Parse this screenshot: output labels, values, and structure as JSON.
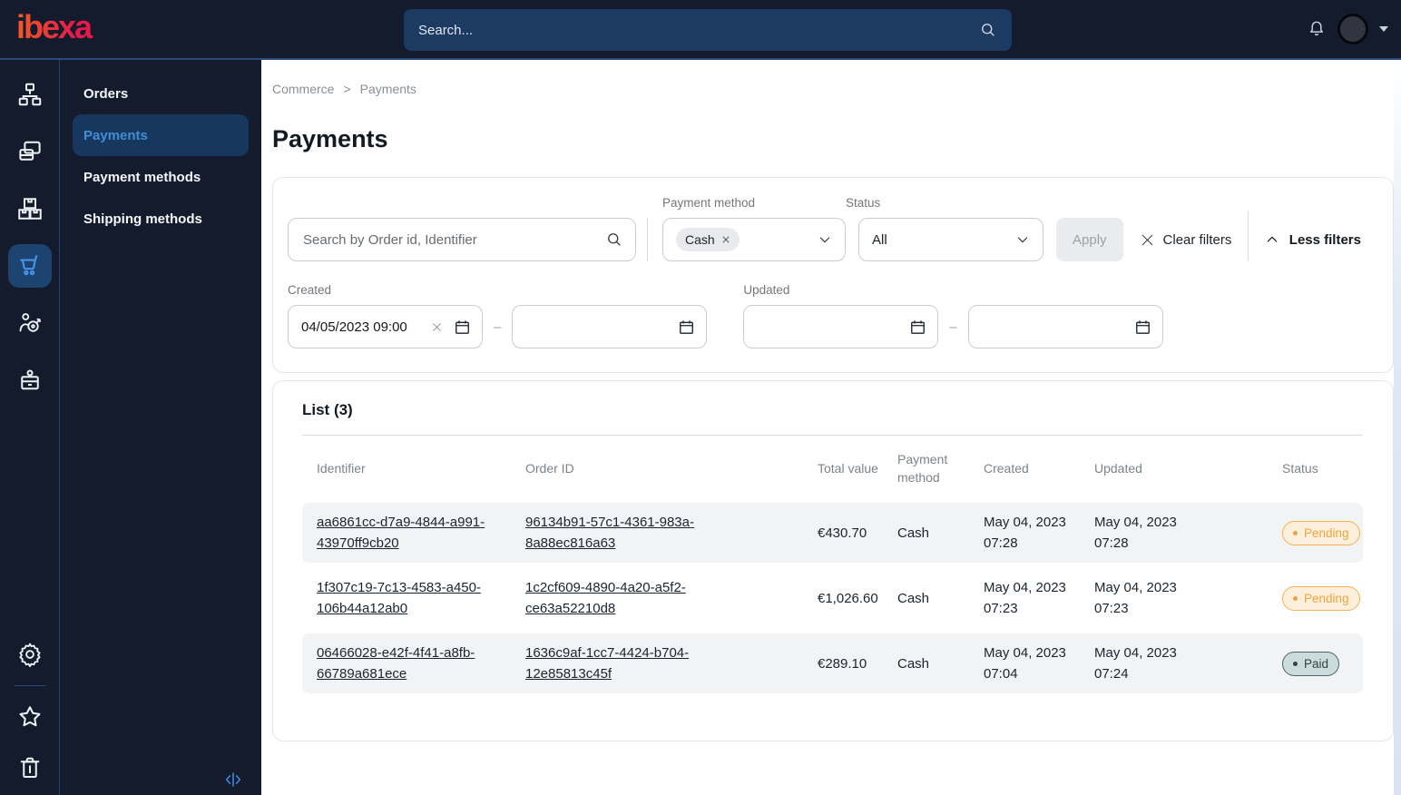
{
  "topbar": {
    "brand": "ibexa",
    "search_placeholder": "Search..."
  },
  "sidebar": {
    "rail": [
      {
        "icon": "sitemap-icon",
        "active": false
      },
      {
        "icon": "pages-icon",
        "active": false
      },
      {
        "icon": "products-icon",
        "active": false
      },
      {
        "icon": "cart-icon",
        "active": true
      },
      {
        "icon": "audience-target-icon",
        "active": false
      },
      {
        "icon": "badge-icon",
        "active": false
      },
      {
        "icon": "gear-icon",
        "active": false
      },
      {
        "icon": "star-icon",
        "active": false
      },
      {
        "icon": "trash-icon",
        "active": false
      }
    ],
    "menu": {
      "items": [
        {
          "label": "Orders",
          "active": false
        },
        {
          "label": "Payments",
          "active": true
        },
        {
          "label": "Payment methods",
          "active": false
        },
        {
          "label": "Shipping methods",
          "active": false
        }
      ]
    }
  },
  "breadcrumb": {
    "items": [
      "Commerce",
      "Payments"
    ],
    "separator": ">"
  },
  "page": {
    "title": "Payments"
  },
  "filters": {
    "search_placeholder": "Search by Order id, Identifier",
    "payment_method": {
      "label": "Payment method",
      "chip": "Cash"
    },
    "status": {
      "label": "Status",
      "value": "All"
    },
    "apply_label": "Apply",
    "clear_label": "Clear filters",
    "toggle_label": "Less filters",
    "range_separator": "–",
    "created": {
      "label": "Created",
      "from": "04/05/2023 09:00",
      "to": ""
    },
    "updated": {
      "label": "Updated",
      "from": "",
      "to": ""
    }
  },
  "list": {
    "title": "List (3)",
    "columns": [
      "Identifier",
      "Order ID",
      "Total value",
      "Payment method",
      "Created",
      "Updated",
      "Status"
    ],
    "rows": [
      {
        "identifier": "aa6861cc-d7a9-4844-a991-43970ff9cb20",
        "order_id": "96134b91-57c1-4361-983a-8a88ec816a63",
        "total_value": "€430.70",
        "payment_method": "Cash",
        "created": "May 04, 2023 07:28",
        "updated": "May 04, 2023 07:28",
        "status": "Pending"
      },
      {
        "identifier": "1f307c19-7c13-4583-a450-106b44a12ab0",
        "order_id": "1c2cf609-4890-4a20-a5f2-ce63a52210d8",
        "total_value": "€1,026.60",
        "payment_method": "Cash",
        "created": "May 04, 2023 07:23",
        "updated": "May 04, 2023 07:23",
        "status": "Pending"
      },
      {
        "identifier": "06466028-e42f-4f41-a8fb-66789a681ece",
        "order_id": "1636c9af-1cc7-4424-b704-12e85813c45f",
        "total_value": "€289.10",
        "payment_method": "Cash",
        "created": "May 04, 2023 07:04",
        "updated": "May 04, 2023 07:24",
        "status": "Paid"
      }
    ]
  },
  "colors": {
    "topbar_bg": "#131b2d",
    "accent_blue": "#3f8ed6",
    "active_menu_bg": "#17375f",
    "brand_gradient_start": "#f15a24",
    "brand_gradient_end": "#e6194b",
    "pending_border": "#f2b050",
    "pending_bg": "#fcf0dc",
    "paid_border": "#48666b",
    "paid_bg": "#ccdbdc",
    "row_alt_bg": "#f2f3f5"
  }
}
